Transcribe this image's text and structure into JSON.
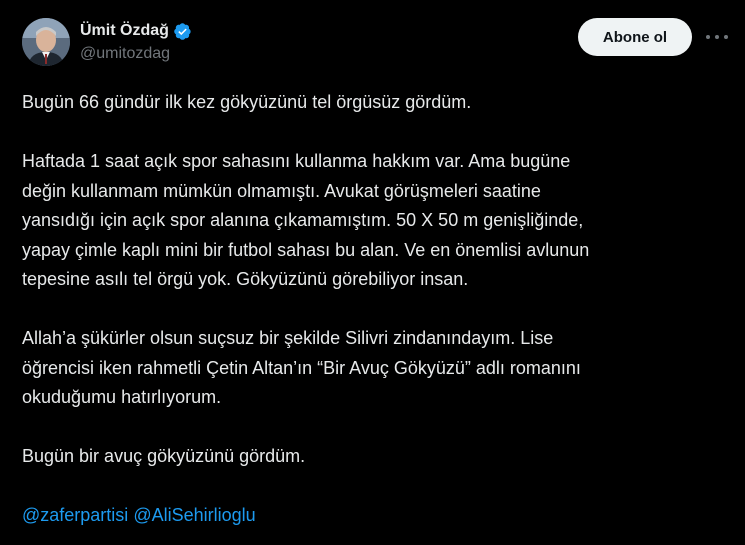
{
  "author": {
    "display_name": "Ümit Özdağ",
    "handle": "@umitozdag",
    "verified": true
  },
  "actions": {
    "follow_label": "Abone ol",
    "more_icon": "more-horizontal-icon"
  },
  "tweet": {
    "paragraphs": [
      [
        "Bugün 66 gündür ilk kez gökyüzünü tel örgüsüz gördüm."
      ],
      [
        "Haftada 1 saat açık spor sahasını kullanma hakkım var. Ama bugüne",
        "değin kullanmam mümkün olmamıştı. Avukat görüşmeleri saatine",
        "yansıdığı için açık spor alanına çıkamamıştım. 50 X 50 m genişliğinde,",
        "yapay çimle kaplı mini bir futbol sahası bu alan. Ve en önemlisi avlunun",
        "tepesine asılı tel örgü yok. Gökyüzünü görebiliyor insan."
      ],
      [
        "Allah’a şükürler olsun suçsuz bir şekilde Silivri zindanındayım. Lise",
        "öğrencisi iken rahmetli Çetin Altan’ın “Bir Avuç Gökyüzü” adlı romanını",
        "okuduğumu hatırlıyorum."
      ],
      [
        "Bugün bir avuç gökyüzünü gördüm."
      ]
    ],
    "mentions": [
      "@zaferpartisi",
      "@AliSehirlioglu"
    ]
  },
  "colors": {
    "background": "#000000",
    "text": "#e7e9ea",
    "secondary_text": "#71767b",
    "link": "#1d9bf0",
    "verified_badge": "#1d9bf0",
    "button_bg": "#eff3f4",
    "button_text": "#0f1419"
  }
}
